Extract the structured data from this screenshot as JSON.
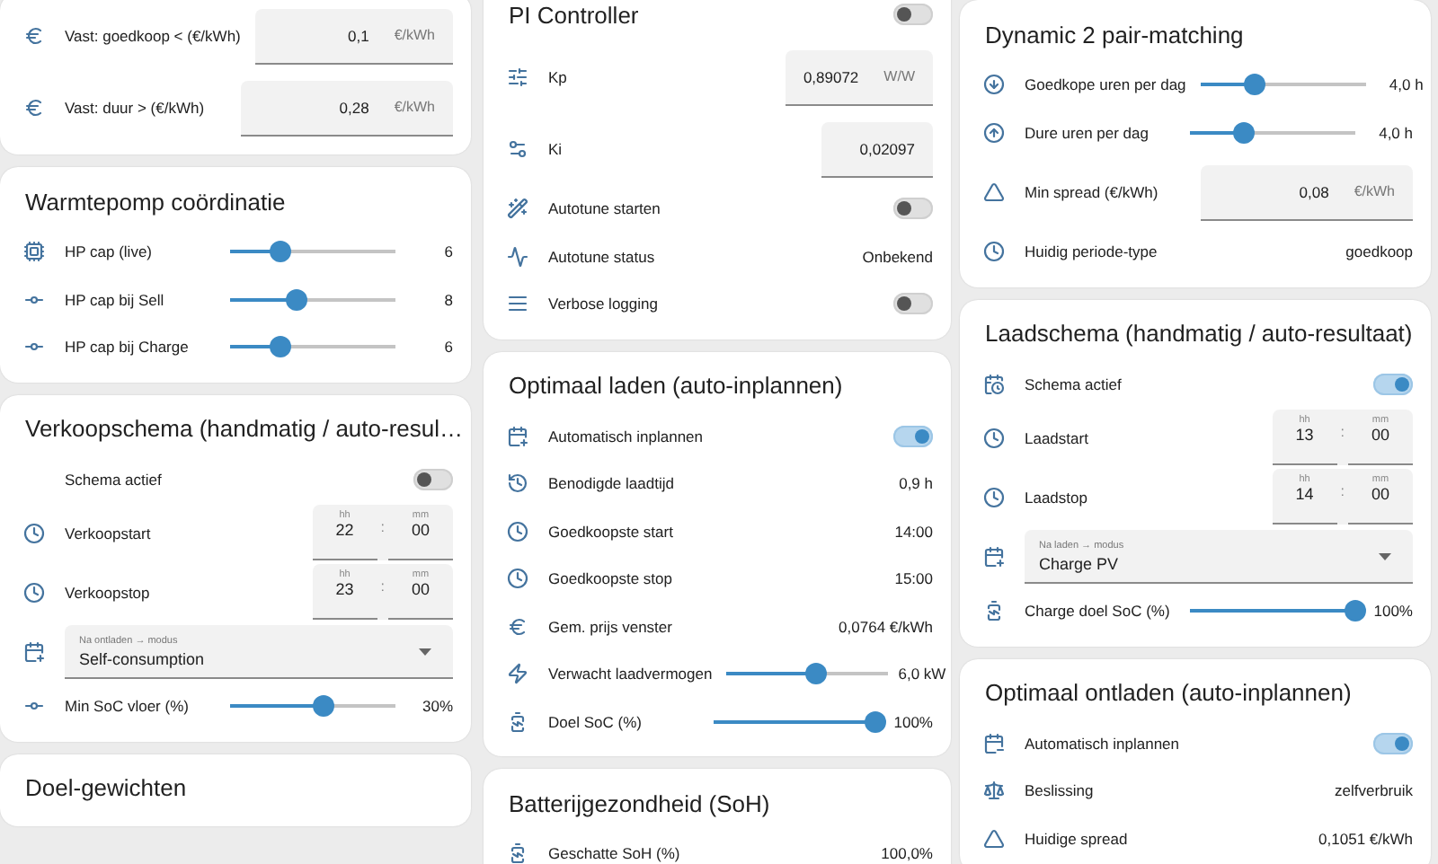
{
  "columns": [
    {
      "cards": [
        {
          "rows": [
            {
              "kind": "number",
              "label": "Vast: goedkoop < (€/kWh)",
              "value": "0,1",
              "unit": "€/kWh"
            },
            {
              "kind": "number",
              "label": "Vast: duur > (€/kWh)",
              "value": "0,28",
              "unit": "€/kWh"
            }
          ]
        },
        {
          "title": "Warmtepomp coördinatie",
          "rows": [
            {
              "kind": "slider",
              "label": "HP cap (live)",
              "level": 0.3,
              "reading": "6"
            },
            {
              "kind": "slider",
              "label": "HP cap bij Sell",
              "level": 0.4,
              "reading": "8"
            },
            {
              "kind": "slider",
              "label": "HP cap bij Charge",
              "level": 0.3,
              "reading": "6"
            }
          ]
        },
        {
          "title": "Verkoopschema (handmatig / auto-resul…",
          "rows": [
            {
              "kind": "toggle",
              "label": "Schema actief",
              "on": false
            },
            {
              "kind": "time",
              "label": "Verkoopstart",
              "hour_label": "hh",
              "minute_label": "mm",
              "hour": "22",
              "separator": ":",
              "minute": "00"
            },
            {
              "kind": "time",
              "label": "Verkoopstop",
              "hour_label": "hh",
              "minute_label": "mm",
              "hour": "23",
              "separator": ":",
              "minute": "00"
            },
            {
              "kind": "select",
              "label": "Na ontladen → modus",
              "value": "Self-consumption"
            },
            {
              "kind": "slider",
              "label": "Min SoC vloer (%)",
              "level": 0.56,
              "reading": "30%"
            }
          ]
        },
        {
          "title": "Doel-gewichten"
        }
      ]
    },
    {
      "cards": [
        {
          "title": "PI Controller",
          "title_toggle": {
            "on": false
          },
          "rows": [
            {
              "kind": "number",
              "label": "Kp",
              "value": "0,89072",
              "unit": "W/W"
            },
            {
              "kind": "number",
              "label": "Ki",
              "value": "0,02097"
            },
            {
              "kind": "toggle",
              "label": "Autotune starten",
              "on": false
            },
            {
              "kind": "text",
              "label": "Autotune status",
              "value": "Onbekend"
            },
            {
              "kind": "toggle",
              "label": "Verbose logging",
              "on": false
            }
          ]
        },
        {
          "title": "Optimaal laden (auto-inplannen)",
          "rows": [
            {
              "kind": "toggle",
              "label": "Automatisch inplannen",
              "on": true
            },
            {
              "kind": "text",
              "label": "Benodigde laadtijd",
              "value": "0,9 h"
            },
            {
              "kind": "text",
              "label": "Goedkoopste start",
              "value": "14:00"
            },
            {
              "kind": "text",
              "label": "Goedkoopste stop",
              "value": "15:00"
            },
            {
              "kind": "text",
              "label": "Gem. prijs venster",
              "value": "0,0764 €/kWh"
            },
            {
              "kind": "slider",
              "label": "Verwacht laadvermogen",
              "level": 0.55,
              "reading": "6,0 kW"
            },
            {
              "kind": "slider",
              "label": "Doel SoC (%)",
              "level": 1,
              "reading": "100%"
            }
          ]
        },
        {
          "title": "Batterijgezondheid (SoH)",
          "rows": [
            {
              "kind": "text",
              "label": "Geschatte SoH (%)",
              "value": "100,0%"
            }
          ]
        }
      ]
    },
    {
      "cards": [
        {
          "title": "Dynamic 2 pair-matching",
          "rows": [
            {
              "kind": "slider",
              "label": "Goedkope uren per dag",
              "level": 0.33,
              "reading": "4,0 h"
            },
            {
              "kind": "slider",
              "label": "Dure uren per dag",
              "level": 0.33,
              "reading": "4,0 h"
            },
            {
              "kind": "number",
              "label": "Min spread (€/kWh)",
              "value": "0,08",
              "unit": "€/kWh"
            },
            {
              "kind": "text",
              "label": "Huidig periode-type",
              "value": "goedkoop"
            }
          ]
        },
        {
          "title": "Laadschema (handmatig / auto-resultaat)",
          "rows": [
            {
              "kind": "toggle",
              "label": "Schema actief",
              "on": true
            },
            {
              "kind": "time",
              "label": "Laadstart",
              "hour_label": "hh",
              "minute_label": "mm",
              "hour": "13",
              "separator": ":",
              "minute": "00"
            },
            {
              "kind": "time",
              "label": "Laadstop",
              "hour_label": "hh",
              "minute_label": "mm",
              "hour": "14",
              "separator": ":",
              "minute": "00"
            },
            {
              "kind": "select",
              "label": "Na laden → modus",
              "value": "Charge PV"
            },
            {
              "kind": "slider",
              "label": "Charge doel SoC (%)",
              "level": 1,
              "reading": "100%"
            }
          ]
        },
        {
          "title": "Optimaal ontladen (auto-inplannen)",
          "rows": [
            {
              "kind": "toggle",
              "label": "Automatisch inplannen",
              "on": true
            },
            {
              "kind": "text",
              "label": "Beslissing",
              "value": "zelfverbruik"
            },
            {
              "kind": "text",
              "label": "Huidige spread",
              "value": "0,1051 €/kWh"
            }
          ]
        }
      ]
    }
  ]
}
